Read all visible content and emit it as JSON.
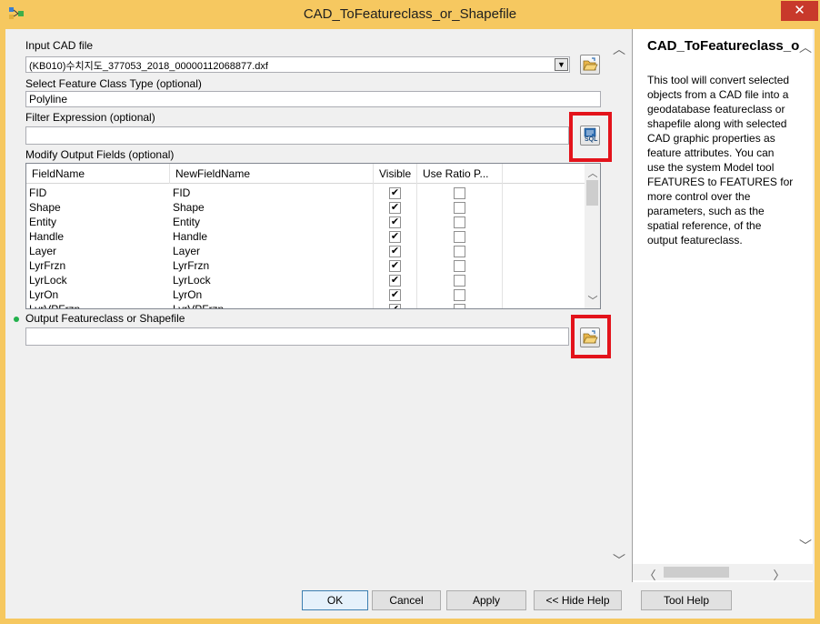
{
  "window": {
    "title": "CAD_ToFeatureclass_or_Shapefile",
    "close_glyph": "✕"
  },
  "form": {
    "input_cad": {
      "label": "Input CAD file",
      "value": "(KB010)수치지도_377053_2018_00000112068877.dxf"
    },
    "feature_class_type": {
      "label": "Select Feature Class Type (optional)",
      "value": "Polyline"
    },
    "filter_expression": {
      "label": "Filter Expression (optional)",
      "value": "",
      "sql_icon_text": "SQL"
    },
    "modify_fields": {
      "label": "Modify Output Fields (optional)",
      "columns": [
        "FieldName",
        "NewFieldName",
        "Visible",
        "Use Ratio P..."
      ],
      "rows": [
        {
          "field": "FID",
          "new": "FID",
          "visible": true,
          "ratio": false
        },
        {
          "field": "Shape",
          "new": "Shape",
          "visible": true,
          "ratio": false
        },
        {
          "field": "Entity",
          "new": "Entity",
          "visible": true,
          "ratio": false
        },
        {
          "field": "Handle",
          "new": "Handle",
          "visible": true,
          "ratio": false
        },
        {
          "field": "Layer",
          "new": "Layer",
          "visible": true,
          "ratio": false
        },
        {
          "field": "LyrFrzn",
          "new": "LyrFrzn",
          "visible": true,
          "ratio": false
        },
        {
          "field": "LyrLock",
          "new": "LyrLock",
          "visible": true,
          "ratio": false
        },
        {
          "field": "LyrOn",
          "new": "LyrOn",
          "visible": true,
          "ratio": false
        },
        {
          "field": "LyrVPFrzn",
          "new": "LyrVPFrzn",
          "visible": true,
          "ratio": false
        }
      ]
    },
    "output": {
      "label": "Output Featureclass or Shapefile",
      "value": ""
    }
  },
  "help": {
    "title": "CAD_ToFeatureclass_or_Shapefile",
    "body": "This tool will convert selected objects from a CAD file into a geodatabase featureclass or shapefile along with selected CAD graphic properties as feature attributes. You can use the system Model tool FEATURES to FEATURES for more control over the parameters, such as the spatial reference, of the output featureclass."
  },
  "buttons": {
    "ok": "OK",
    "cancel": "Cancel",
    "apply": "Apply",
    "hide_help": "<< Hide Help",
    "tool_help": "Tool Help"
  },
  "colors": {
    "titlebar": "#f6c860",
    "highlight": "#e3131b",
    "required_dot": "#22b14c"
  }
}
